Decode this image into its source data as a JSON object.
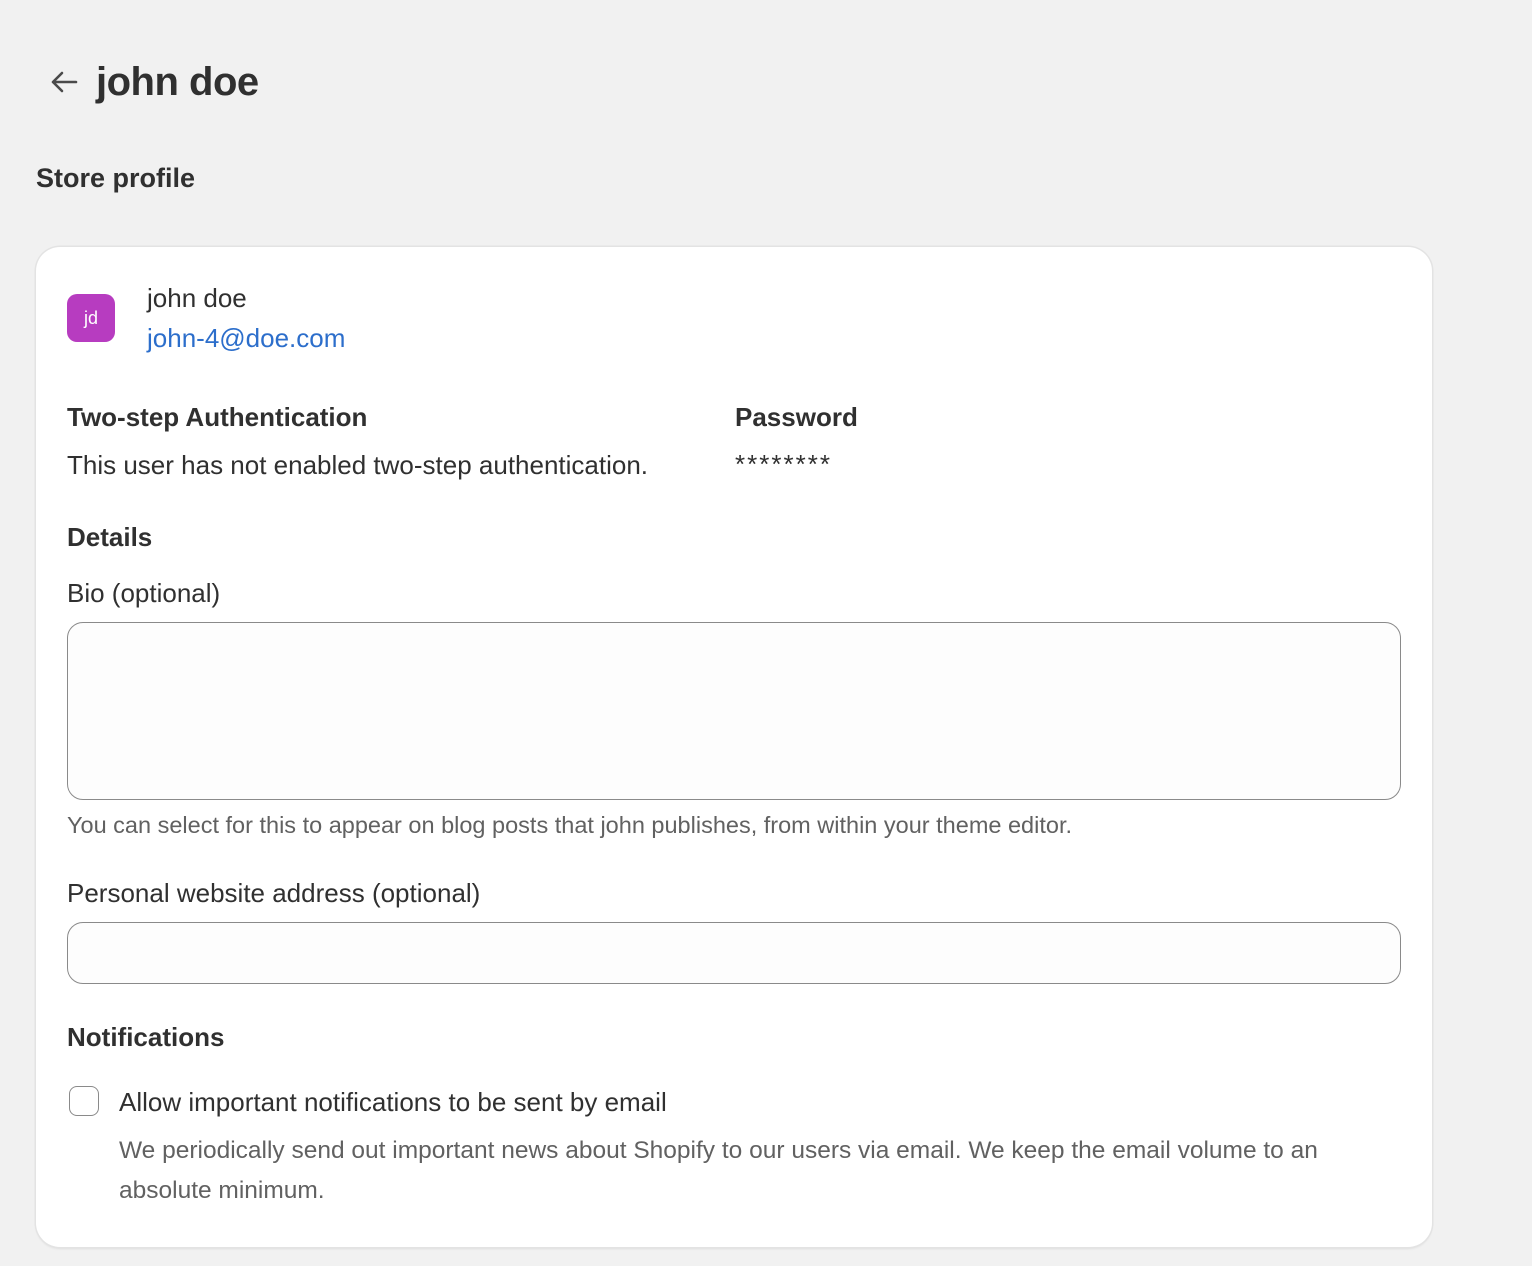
{
  "header": {
    "title": "john doe",
    "back_icon": "arrow-left-icon"
  },
  "section": {
    "title": "Store profile"
  },
  "profile": {
    "initials": "jd",
    "name": "john doe",
    "email": "john-4@doe.com",
    "avatar_color": "#b73cc0"
  },
  "two_step": {
    "heading": "Two-step Authentication",
    "text": "This user has not enabled two-step authentication."
  },
  "password": {
    "heading": "Password",
    "value": "********"
  },
  "details": {
    "heading": "Details",
    "bio_label": "Bio (optional)",
    "bio_value": "",
    "bio_help": "You can select for this to appear on blog posts that john publishes, from within your theme editor.",
    "website_label": "Personal website address (optional)",
    "website_value": ""
  },
  "notifications": {
    "heading": "Notifications",
    "checkbox_label": "Allow important notifications to be sent by email",
    "checkbox_checked": false,
    "help": "We periodically send out important news about Shopify to our users via email. We keep the email volume to an absolute minimum."
  },
  "colors": {
    "background": "#f1f1f1",
    "card": "#ffffff",
    "link": "#2c6ecb",
    "text": "#303030",
    "muted": "#616161"
  }
}
